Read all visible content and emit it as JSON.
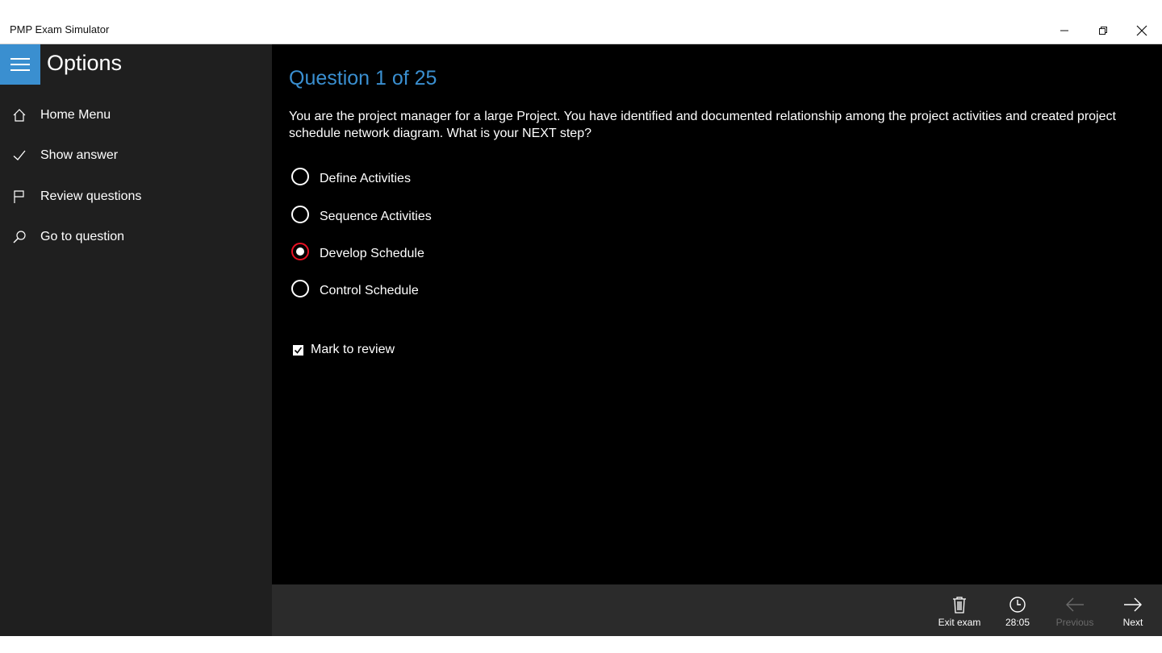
{
  "window": {
    "title": "PMP Exam Simulator",
    "controls": [
      "minimize-icon",
      "restore-icon",
      "close-icon"
    ]
  },
  "sidebar": {
    "title": "Options",
    "menu_icon": "hamburger-icon",
    "accent_color": "#3a8fd0",
    "items": [
      {
        "label": "Home Menu",
        "icon": "home-icon"
      },
      {
        "label": "Show answer",
        "icon": "checkmark-icon"
      },
      {
        "label": "Review questions",
        "icon": "flag-icon"
      },
      {
        "label": "Go to question",
        "icon": "search-icon"
      }
    ]
  },
  "question": {
    "title": "Question 1 of 25",
    "text": "You are the project manager for a large Project. You have identified and documented relationship among the project activities and created project schedule network diagram. What is your NEXT step?",
    "options": [
      {
        "label": "Define Activities",
        "selected": false
      },
      {
        "label": "Sequence Activities",
        "selected": false
      },
      {
        "label": "Develop Schedule",
        "selected": true
      },
      {
        "label": "Control Schedule",
        "selected": false
      }
    ],
    "selected_color": "#e81123",
    "mark_to_review": {
      "label": "Mark to review",
      "checked": true
    }
  },
  "commandbar": {
    "exit": {
      "label": "Exit exam",
      "icon": "trash-icon"
    },
    "timer": {
      "label": "28:05",
      "icon": "clock-icon"
    },
    "previous": {
      "label": "Previous",
      "icon": "arrow-left-icon",
      "disabled": true
    },
    "next": {
      "label": "Next",
      "icon": "arrow-right-icon",
      "disabled": false
    }
  }
}
